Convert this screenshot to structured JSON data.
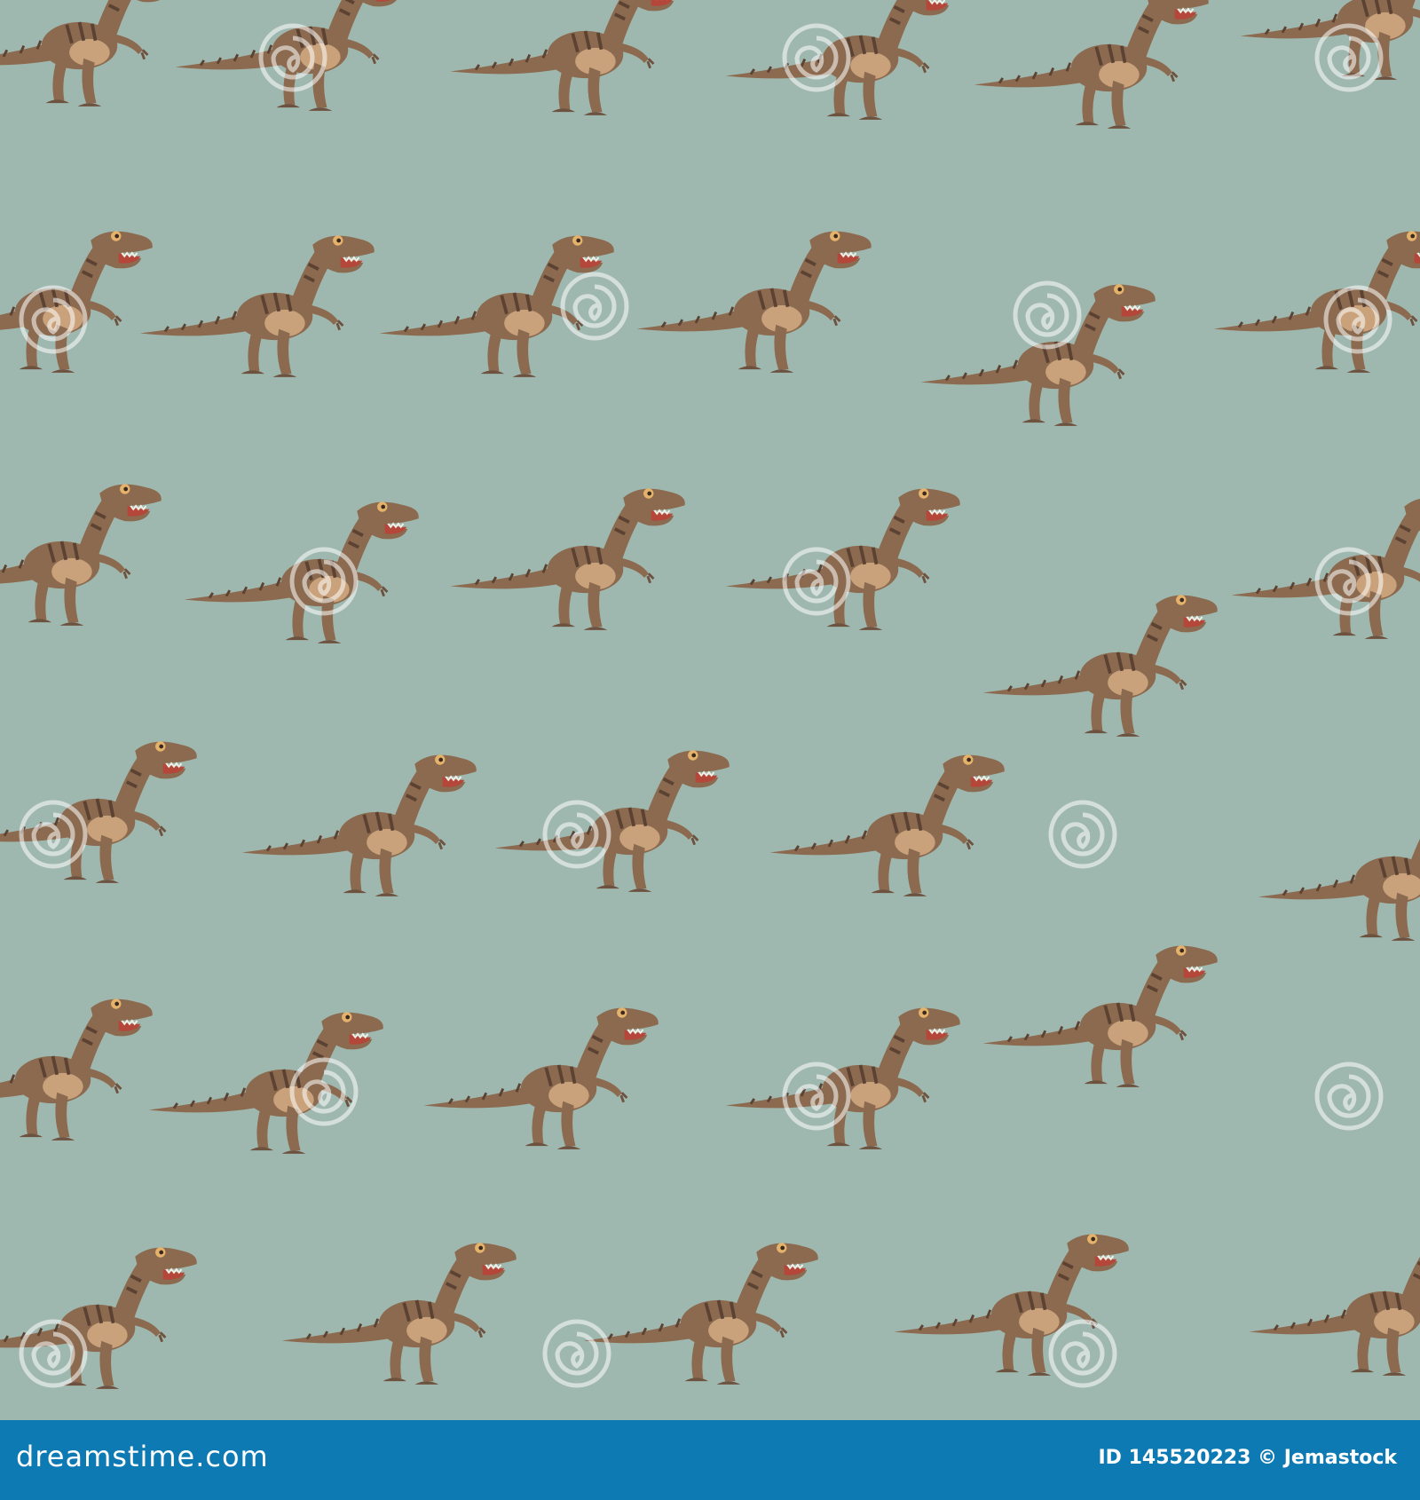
{
  "image": {
    "description_kind": "seamless pattern of cartoon velociraptors",
    "background_color": "#9fb8af",
    "dino_colors": {
      "body": "#8b6a4f",
      "belly": "#c9a27c",
      "stripe": "#5c4232",
      "outline": "#6e5240",
      "teeth": "#f2efe4",
      "mouth": "#b5473a"
    },
    "watermark": {
      "icon": "spiral-logo-icon",
      "text": "dreamstime"
    }
  },
  "footer": {
    "brand": "dreamstime.com",
    "image_id_label": "ID 145520223",
    "copyright": "©",
    "author": "Jemastock",
    "bar_color": "#0e7ab3"
  }
}
